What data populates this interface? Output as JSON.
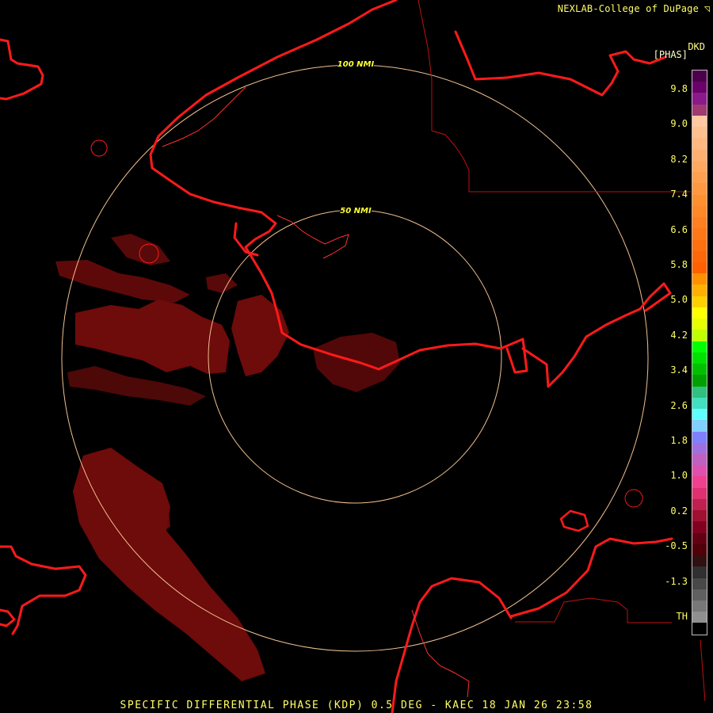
{
  "header": {
    "credit": "NEXLAB-College of DuPage",
    "credit_mark": "◹",
    "product_code": "DKD",
    "units": "[PHAS]"
  },
  "range_rings": [
    {
      "label": "100 NMI"
    },
    {
      "label": "50 NMI"
    }
  ],
  "colorbar": {
    "ticks": [
      "9.8",
      "9.0",
      "8.2",
      "7.4",
      "6.6",
      "5.8",
      "5.0",
      "4.2",
      "3.4",
      "2.6",
      "1.8",
      "1.0",
      "0.2",
      "-0.5",
      "-1.3",
      "TH"
    ],
    "colors": [
      "#4a004a",
      "#6a006a",
      "#8a1a8a",
      "#a03a70",
      "#ffc8a0",
      "#ffc090",
      "#ffb880",
      "#ffb070",
      "#ffa860",
      "#ffa050",
      "#ff9840",
      "#ff9030",
      "#ff8828",
      "#ff8020",
      "#ff7818",
      "#ff7010",
      "#ff6808",
      "#ff6000",
      "#ff9000",
      "#ffb000",
      "#ffd000",
      "#ffff00",
      "#e8ff00",
      "#c0ff00",
      "#00ff00",
      "#00e000",
      "#00c000",
      "#00a000",
      "#30c080",
      "#40e0c0",
      "#60ffff",
      "#80d0ff",
      "#8080ff",
      "#a070e0",
      "#c060c0",
      "#e050b0",
      "#f04090",
      "#e03070",
      "#c02050",
      "#a01030",
      "#800020",
      "#600010",
      "#500008",
      "#301010",
      "#303030",
      "#484848",
      "#606060",
      "#787878",
      "#909090",
      "#000000"
    ]
  },
  "footer": {
    "text": "SPECIFIC DIFFERENTIAL PHASE (KDP) 0.5 DEG - KAEC 18 JAN 26 23:58"
  },
  "map": {
    "radar_site": "KAEC",
    "ring_color": "#f0c090",
    "coast_color": "#ff1a1a",
    "echo_color": "#6e0b0b",
    "label_color": "#ffff33"
  }
}
